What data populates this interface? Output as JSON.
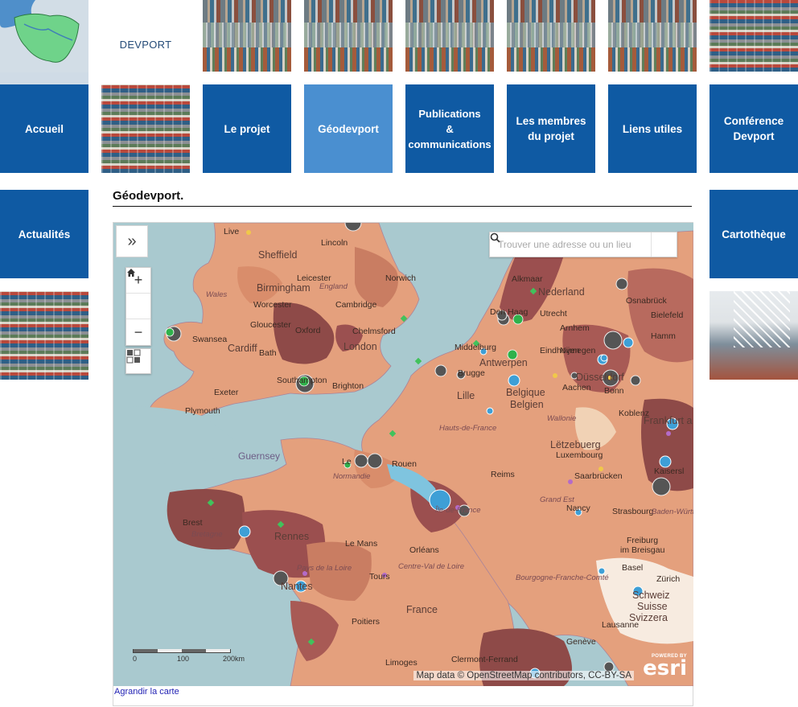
{
  "brand": {
    "label": "DEVPORT"
  },
  "nav": {
    "home": "Accueil",
    "project": "Le projet",
    "geodevport": "Géodevport",
    "publications": "Publications\n&\ncommunications",
    "members": "Les membres\ndu projet",
    "links": "Liens utiles",
    "conference": "Conférence\nDevport",
    "news": "Actualités",
    "map_library": "Cartothèque"
  },
  "page": {
    "title": "Géodevport."
  },
  "map": {
    "search_placeholder": "Trouver une adresse ou un lieu",
    "zoom_in": "+",
    "zoom_out": "−",
    "scale_labels": [
      "0",
      "100",
      "200km"
    ],
    "attribution": "Map data © OpenStreetMap contributors, CC-BY-SA",
    "esri_powered": "POWERED BY",
    "esri_name": "esri",
    "enlarge_link": "Agrandir la carte",
    "place_labels": {
      "liverpool": "Live",
      "sheffield": "Sheffield",
      "lincoln": "Lincoln",
      "leicester": "Leicester",
      "norwich": "Norwich",
      "birmingham": "Birmingham",
      "england": "England",
      "wales": "Wales",
      "worcester": "Worcester",
      "cambridge": "Cambridge",
      "alkmaar": "Alkmaar",
      "nederland": "Nederland",
      "gloucester": "Gloucester",
      "oxford": "Oxford",
      "chelmsford": "Chelmsford",
      "swansea": "Swansea",
      "cardiff": "Cardiff",
      "bath": "Bath",
      "london": "London",
      "den_haag": "Den Haag",
      "utrecht": "Utrecht",
      "middelburg": "Middelburg",
      "hamm": "Hamm",
      "osnabruck": "Osnabrück",
      "bielefeld": "Bielefeld",
      "arnhem": "Arnhem",
      "nijmegen": "Nijmegen",
      "brugge": "Brugge",
      "antwerpen": "Antwerpen",
      "eindhoven": "Eindhoven",
      "dusseldorf": "Düsseldorf",
      "southampton": "Southampton",
      "brighton": "Brighton",
      "exeter": "Exeter",
      "lille": "Lille",
      "belgique": "Belgique",
      "belgien": "Belgien",
      "aachen": "Aachen",
      "bonn": "Bonn",
      "wallonie": "Wallonie",
      "plymouth": "Plymouth",
      "koblenz": "Koblenz",
      "frankfurt": "Frankfurt a",
      "letzebuerg": "Lëtzebuerg",
      "luxembourg": "Luxembourg",
      "guernsey": "Guernsey",
      "le_havre": "Le",
      "rouen": "Rouen",
      "reims": "Reims",
      "hauts_de_france": "Hauts-de-France",
      "normandie": "Normandie",
      "ile_de_france": "Île-de-France",
      "saarbrucken": "Saarbrücken",
      "grand_est": "Grand Est",
      "kaiserslautern": "Kaisersl",
      "brest": "Brest",
      "rennes": "Rennes",
      "le_mans": "Le Mans",
      "orleans": "Orléans",
      "nancy": "Nancy",
      "strasbourg": "Strasbourg",
      "baden_wurttemberg": "Baden-Württ",
      "freiburg": "Freiburg",
      "im_breisgau": "im Breisgau",
      "basel": "Basel",
      "bourgogne": "Bourgogne-Franche-Comté",
      "schweiz": "Schweiz",
      "suisse": "Suisse",
      "svizzera": "Svizzera",
      "zurich": "Zürich",
      "centre": "Centre-Val de Loire",
      "pays_de_la_loire": "Pays de la Loire",
      "tours": "Tours",
      "nantes": "Nantes",
      "france": "France",
      "poitiers": "Poitiers",
      "lausanne": "Lausanne",
      "geneve": "Genève",
      "limoges": "Limoges",
      "clermont": "Clermont-Ferrand",
      "bretagne": "Bretagne"
    }
  }
}
